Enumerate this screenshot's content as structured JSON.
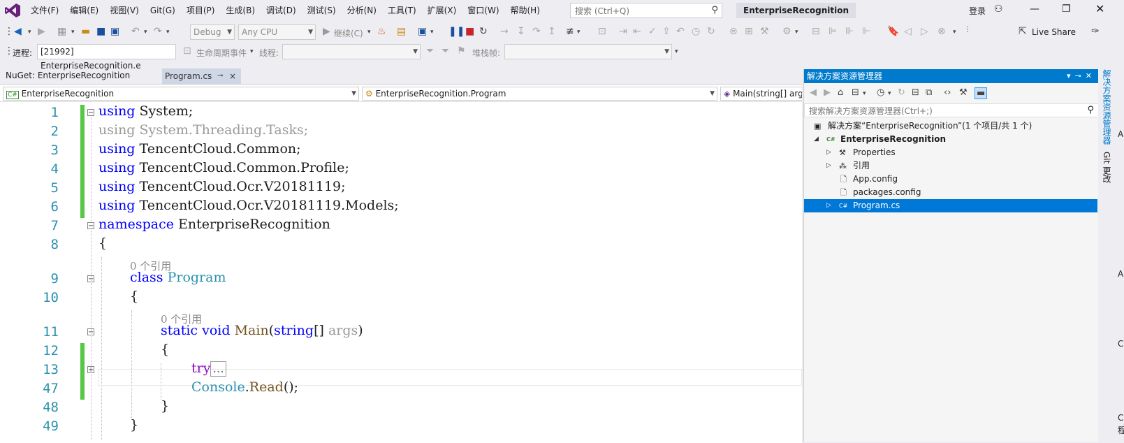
{
  "menubar": {
    "items": [
      "文件(F)",
      "编辑(E)",
      "视图(V)",
      "Git(G)",
      "项目(P)",
      "生成(B)",
      "调试(D)",
      "测试(S)",
      "分析(N)",
      "工具(T)",
      "扩展(X)",
      "窗口(W)",
      "帮助(H)"
    ],
    "search_placeholder": "搜索 (Ctrl+Q)",
    "solution_name": "EnterpriseRecognition",
    "login": "登录"
  },
  "toolbar1": {
    "config": "Debug",
    "platform": "Any CPU",
    "continue": "继续(C)",
    "live_share": "Live Share"
  },
  "toolbar2": {
    "process_label": "进程:",
    "process_value": "[21992] EnterpriseRecognition.e",
    "lifecycle_label": "生命周期事件",
    "thread_label": "线程:",
    "stack_label": "堆栈帧:"
  },
  "tabs": {
    "nuget": "NuGet: EnterpriseRecognition",
    "program": "Program.cs",
    "pin": "⊸",
    "close": "×"
  },
  "navbar": {
    "project": "EnterpriseRecognition",
    "class": "EnterpriseRecognition.Program",
    "member": "Main(string[] args)"
  },
  "code": {
    "line_numbers": [
      "1",
      "2",
      "3",
      "4",
      "5",
      "6",
      "7",
      "8",
      "9",
      "10",
      "11",
      "12",
      "13",
      "47",
      "48",
      "49"
    ],
    "codelens": "0 个引用",
    "l1": [
      "using",
      " System;"
    ],
    "l2": [
      "using",
      " System.Threading.Tasks;"
    ],
    "l3": [
      "using",
      " TencentCloud.Common;"
    ],
    "l4": [
      "using",
      " TencentCloud.Common.Profile;"
    ],
    "l5": [
      "using",
      " TencentCloud.Ocr.V20181119;"
    ],
    "l6": [
      "using",
      " TencentCloud.Ocr.V20181119.Models;"
    ],
    "l7": [
      "namespace",
      " EnterpriseRecognition"
    ],
    "l8": "{",
    "l9": [
      "class",
      " ",
      "Program"
    ],
    "l10": "{",
    "l11": [
      "static",
      " ",
      "void",
      " ",
      "Main",
      "(",
      "string",
      "[] ",
      "args",
      ")"
    ],
    "l12": "{",
    "l13": [
      "try",
      "..."
    ],
    "l47": [
      "Console",
      ".",
      "Read",
      "();"
    ],
    "l48": "}",
    "l49": "}"
  },
  "solution_explorer": {
    "title": "解决方案资源管理器",
    "search_placeholder": "搜索解决方案资源管理器(Ctrl+;)",
    "solution": "解决方案“EnterpriseRecognition”(1 个项目/共 1 个)",
    "project": "EnterpriseRecognition",
    "items": [
      "Properties",
      "引用",
      "App.config",
      "packages.config",
      "Program.cs"
    ]
  },
  "side_strip": {
    "tab1": "解决方案资源管理器",
    "tab2": "Git 更改",
    "letters": [
      "A",
      "A",
      "C",
      "C",
      "程"
    ]
  },
  "colors": {
    "accent": "#007acc",
    "selection": "#0078d7",
    "keyword": "#0000ff",
    "type": "#2b91af",
    "change_bar": "#57c746"
  }
}
